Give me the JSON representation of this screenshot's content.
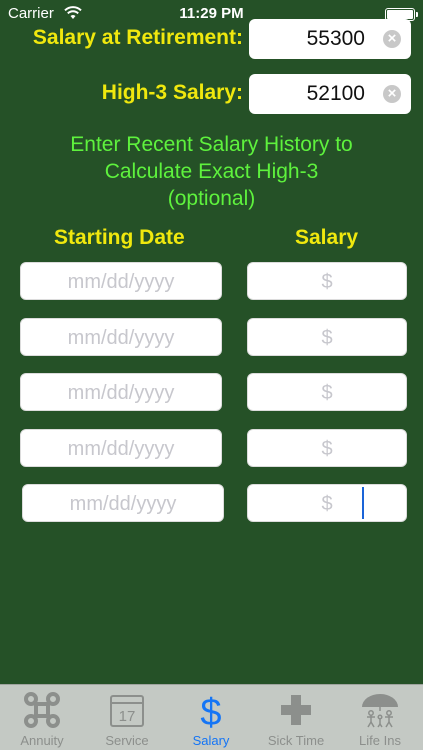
{
  "status_bar": {
    "carrier": "Carrier",
    "time": "11:29 PM"
  },
  "fields": {
    "salary_at_retirement": {
      "label": "Salary at Retirement:",
      "value": "55300"
    },
    "high3_salary": {
      "label": "High-3 Salary:",
      "value": "52100"
    }
  },
  "instructions": [
    "Enter Recent Salary History to",
    "Calculate Exact High-3",
    "(optional)"
  ],
  "history": {
    "headers": {
      "date": "Starting Date",
      "salary": "Salary"
    },
    "rows": [
      {
        "date_placeholder": "mm/dd/yyyy",
        "salary_placeholder": "$"
      },
      {
        "date_placeholder": "mm/dd/yyyy",
        "salary_placeholder": "$"
      },
      {
        "date_placeholder": "mm/dd/yyyy",
        "salary_placeholder": "$"
      },
      {
        "date_placeholder": "mm/dd/yyyy",
        "salary_placeholder": "$"
      },
      {
        "date_placeholder": "mm/dd/yyyy",
        "salary_placeholder": "$"
      }
    ]
  },
  "tab_bar": {
    "active": "salary",
    "tabs": [
      {
        "id": "annuity",
        "label": "Annuity",
        "icon": "command-icon"
      },
      {
        "id": "service",
        "label": "Service",
        "icon": "calendar-icon",
        "calendar_day": "17"
      },
      {
        "id": "salary",
        "label": "Salary",
        "icon": "dollar-icon"
      },
      {
        "id": "sick_time",
        "label": "Sick Time",
        "icon": "medical-cross-icon"
      },
      {
        "id": "life_ins",
        "label": "Life Ins",
        "icon": "umbrella-family-icon"
      }
    ]
  },
  "colors": {
    "background": "#255127",
    "label_yellow": "#f0e80e",
    "instruction_green": "#5ef23d",
    "active_tab": "#1575f5"
  }
}
